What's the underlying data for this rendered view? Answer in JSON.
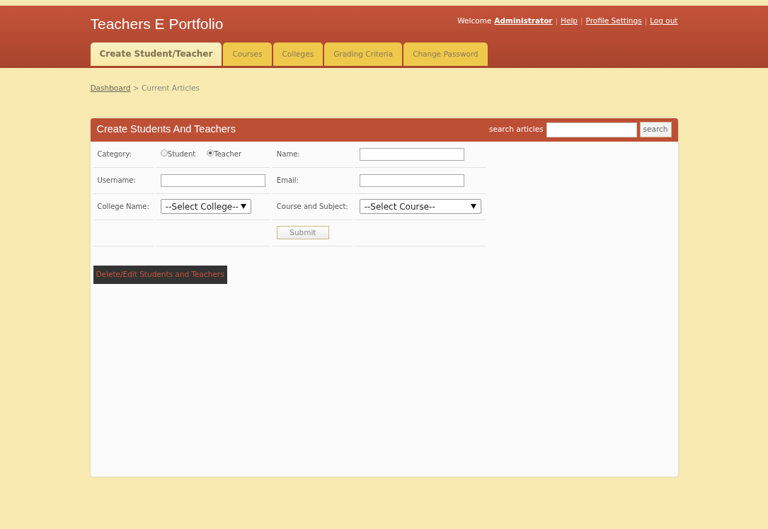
{
  "site_title": "Teachers E Portfolio",
  "user_bar": {
    "welcome": "Welcome",
    "user": "Administrator",
    "separator": "|",
    "links": [
      "Help",
      "Profile Settings",
      "Log out"
    ]
  },
  "tabs": [
    {
      "label": "Create Student/Teacher",
      "selected": true
    },
    {
      "label": "Courses",
      "selected": false
    },
    {
      "label": "Colleges",
      "selected": false
    },
    {
      "label": "Grading Criteria",
      "selected": false
    },
    {
      "label": "Change Password",
      "selected": false
    }
  ],
  "breadcrumb": {
    "link": "Dashboard",
    "separator": ">",
    "current": "Current Articles"
  },
  "panel": {
    "title": "Create Students And Teachers",
    "search_label": "search articles",
    "search_button": "search"
  },
  "form": {
    "category_label": "Category:",
    "categories": [
      {
        "label": "Student",
        "selected": false
      },
      {
        "label": "Teacher",
        "selected": true
      }
    ],
    "name_label": "Name:",
    "username_label": "Username:",
    "email_label": "Email:",
    "college_label": "College Name:",
    "college_select": "--Select College--",
    "course_label": "Course and Subject:",
    "course_select": "--Select Course--",
    "submit": "Submit"
  },
  "manage_link": "Delete/Edit Students and Teachers"
}
